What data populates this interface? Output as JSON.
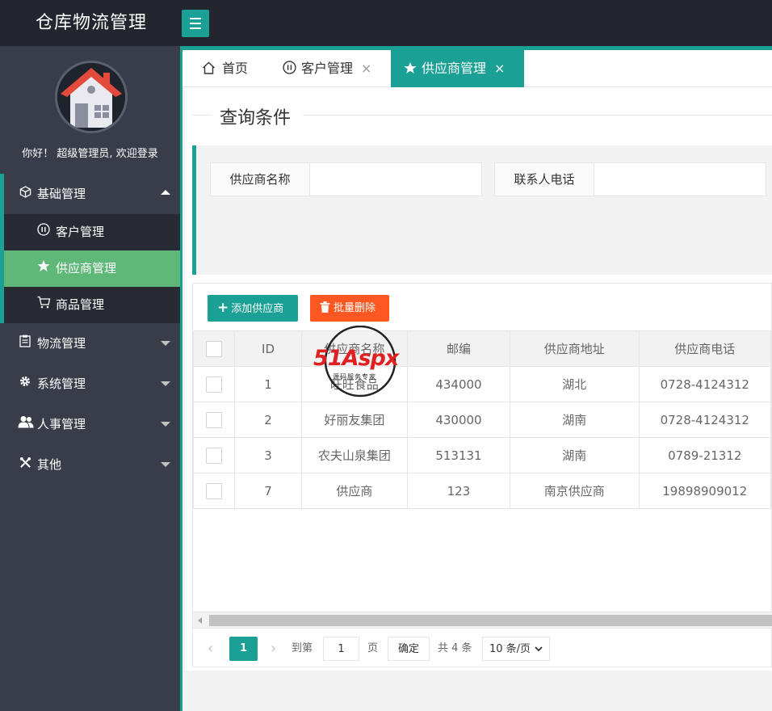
{
  "header": {
    "title": "仓库物流管理"
  },
  "sidebar": {
    "welcome": "你好！ 超级管理员, 欢迎登录",
    "groups": [
      {
        "label": "基础管理",
        "icon": "cube-icon",
        "open": true
      },
      {
        "label": "物流管理",
        "icon": "clipboard-icon"
      },
      {
        "label": "系统管理",
        "icon": "gear-icon"
      },
      {
        "label": "人事管理",
        "icon": "users-icon"
      },
      {
        "label": "其他",
        "icon": "tools-icon"
      }
    ],
    "sub_items": [
      {
        "label": "客户管理",
        "icon": "pause-circle-icon"
      },
      {
        "label": "供应商管理",
        "icon": "star-icon",
        "active": true
      },
      {
        "label": "商品管理",
        "icon": "cart-icon"
      }
    ]
  },
  "tabs": [
    {
      "label": "首页",
      "icon": "home-icon"
    },
    {
      "label": "客户管理",
      "icon": "pause-circle-icon",
      "close": "×"
    },
    {
      "label": "供应商管理",
      "icon": "star-icon",
      "close": "×",
      "active": true
    }
  ],
  "query": {
    "legend": "查询条件",
    "fields": [
      {
        "label": "供应商名称",
        "value": ""
      },
      {
        "label": "联系人电话",
        "value": ""
      }
    ]
  },
  "toolbar": {
    "add_label": "添加供应商",
    "delete_label": "批量删除"
  },
  "table": {
    "columns": [
      "ID",
      "供应商名称",
      "邮编",
      "供应商地址",
      "供应商电话"
    ],
    "rows": [
      [
        "1",
        "旺旺食品",
        "434000",
        "湖北",
        "0728-4124312"
      ],
      [
        "2",
        "好丽友集团",
        "430000",
        "湖南",
        "0728-4124312"
      ],
      [
        "3",
        "农夫山泉集团",
        "513131",
        "湖南",
        "0789-21312"
      ],
      [
        "7",
        "供应商",
        "123",
        "南京供应商",
        "19898909012"
      ]
    ]
  },
  "pagination": {
    "current": "1",
    "goto_label": "到第",
    "goto_value": "1",
    "page_unit": "页",
    "confirm": "确定",
    "total": "共 4 条",
    "page_size": "10 条/页"
  },
  "watermark": {
    "brand": "51Aspx",
    "slogan": "源码服务专家"
  },
  "colors": {
    "accent": "#1aa094",
    "active_menu": "#5fb878",
    "danger": "#ff5722",
    "header_bg": "#23262e",
    "sidebar_bg": "#383d49"
  }
}
